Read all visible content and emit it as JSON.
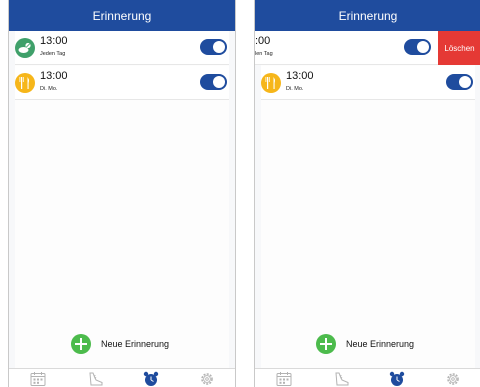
{
  "screens": [
    {
      "header": {
        "title": "Erinnerung"
      },
      "reminders": [
        {
          "time": "13:00",
          "repeat": "Jeden Tag",
          "icon": "pill-icon",
          "enabled": true
        },
        {
          "time": "13:00",
          "repeat": "Di. Mo.",
          "icon": "cutlery-icon",
          "enabled": true
        }
      ],
      "new_button_label": "Neue Erinnerung",
      "tabs": [
        "calendar-icon",
        "shoe-icon",
        "alarm-clock-icon",
        "gear-icon"
      ]
    },
    {
      "header": {
        "title": "Erinnerung"
      },
      "reminders": [
        {
          "time": ":00",
          "repeat": "len Tag",
          "icon": "pill-icon",
          "enabled": true
        },
        {
          "time": "13:00",
          "repeat": "Di. Mo.",
          "icon": "cutlery-icon",
          "enabled": true
        }
      ],
      "delete_label": "Löschen",
      "new_button_label": "Neue Erinnerung",
      "tabs": [
        "calendar-icon",
        "shoe-icon",
        "alarm-clock-icon",
        "gear-icon"
      ]
    }
  ],
  "colors": {
    "primary": "#1f4c9e",
    "delete": "#e53935",
    "add": "#4cbb4c",
    "icon_green": "#3fa06a",
    "icon_yellow": "#f6b61a",
    "tab_inactive": "#b3b3b3",
    "tab_active": "#1f4c9e"
  }
}
